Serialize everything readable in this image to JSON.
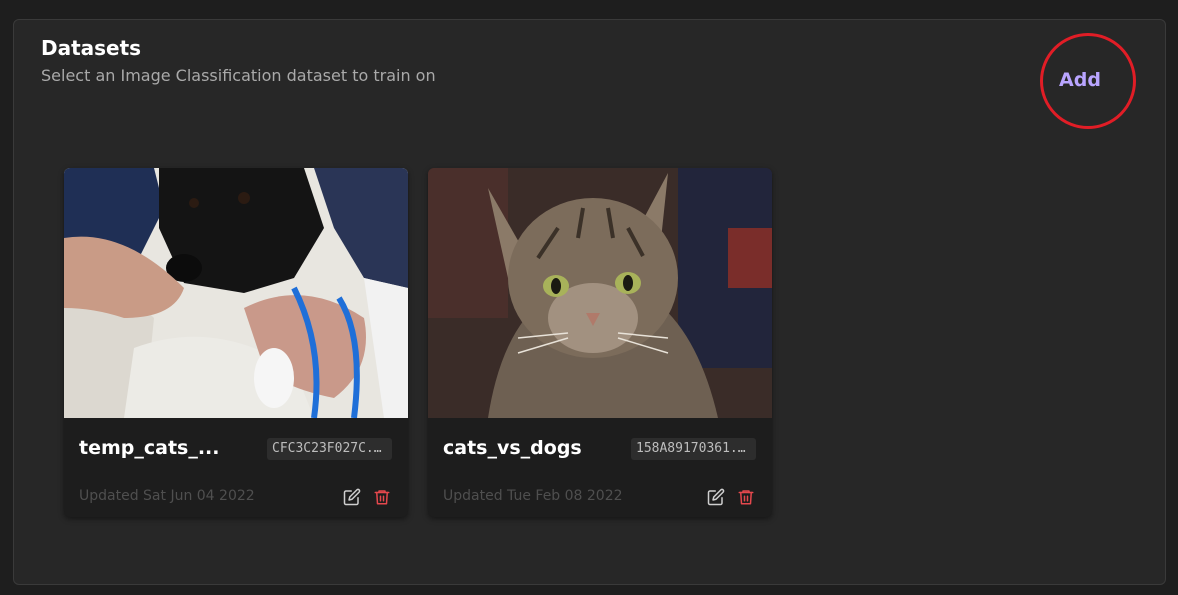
{
  "header": {
    "title": "Datasets",
    "subtitle": "Select an Image Classification dataset to train on",
    "add_label": "Add"
  },
  "datasets": [
    {
      "name": "temp_cats_...",
      "id": "CFC3C23F027C...",
      "updated": "Updated Sat Jun 04 2022",
      "thumbnail_icon": "dog-photo"
    },
    {
      "name": "cats_vs_dogs",
      "id": "158A89170361...",
      "updated": "Updated Tue Feb 08 2022",
      "thumbnail_icon": "cat-photo"
    }
  ],
  "icons": {
    "edit": "edit-icon",
    "delete": "trash-icon"
  },
  "colors": {
    "accent": "#b9a5ff",
    "highlight_ring": "#e11d26",
    "delete": "#e5484d",
    "edit": "#cfcfcf"
  }
}
